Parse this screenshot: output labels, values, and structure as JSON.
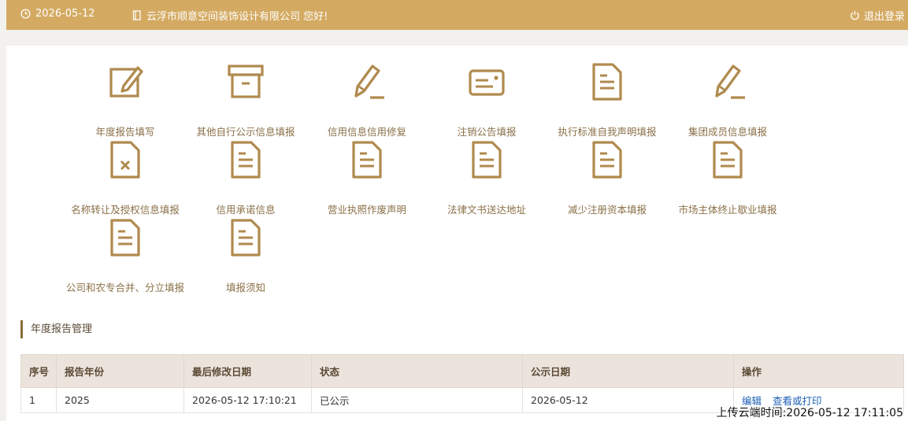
{
  "header": {
    "date": "2026-05-12",
    "greeting": "云浮市顺意空间装饰设计有限公司 您好!",
    "logout_label": "退出登录"
  },
  "tiles": [
    {
      "label": "年度报告填写",
      "icon": "edit-icon"
    },
    {
      "label": "其他自行公示信息填报",
      "icon": "archive-box-icon"
    },
    {
      "label": "信用信息信用修复",
      "icon": "pencil-icon"
    },
    {
      "label": "注销公告填报",
      "icon": "card-icon"
    },
    {
      "label": "执行标准自我声明填报",
      "icon": "document-icon"
    },
    {
      "label": "集团成员信息填报",
      "icon": "pencil-icon"
    },
    {
      "label": "名称转让及授权信息填报",
      "icon": "document-x-icon"
    },
    {
      "label": "信用承诺信息",
      "icon": "document-icon"
    },
    {
      "label": "营业执照作废声明",
      "icon": "document-icon"
    },
    {
      "label": "法律文书送达地址",
      "icon": "document-icon"
    },
    {
      "label": "减少注册资本填报",
      "icon": "document-icon"
    },
    {
      "label": "市场主体终止歇业填报",
      "icon": "document-icon"
    },
    {
      "label": "公司和农专合并、分立填报",
      "icon": "document-icon"
    },
    {
      "label": "填报须知",
      "icon": "document-icon"
    }
  ],
  "annual_report": {
    "title": "年度报告管理",
    "columns": [
      "序号",
      "报告年份",
      "最后修改日期",
      "状态",
      "公示日期",
      "操作"
    ],
    "rows": [
      {
        "index": "1",
        "year": "2025",
        "modified": "2026-05-12 17:10:21",
        "status": "已公示",
        "publish_date": "2026-05-12",
        "action_edit": "编辑",
        "action_view": "查看或打印"
      }
    ]
  },
  "overlay_text": "上传云端时间:2026-05-12 17:11:05",
  "colors": {
    "header_bg": "#d4aa62",
    "icon": "#b08a4e",
    "table_header_bg": "#ebe3dc"
  }
}
